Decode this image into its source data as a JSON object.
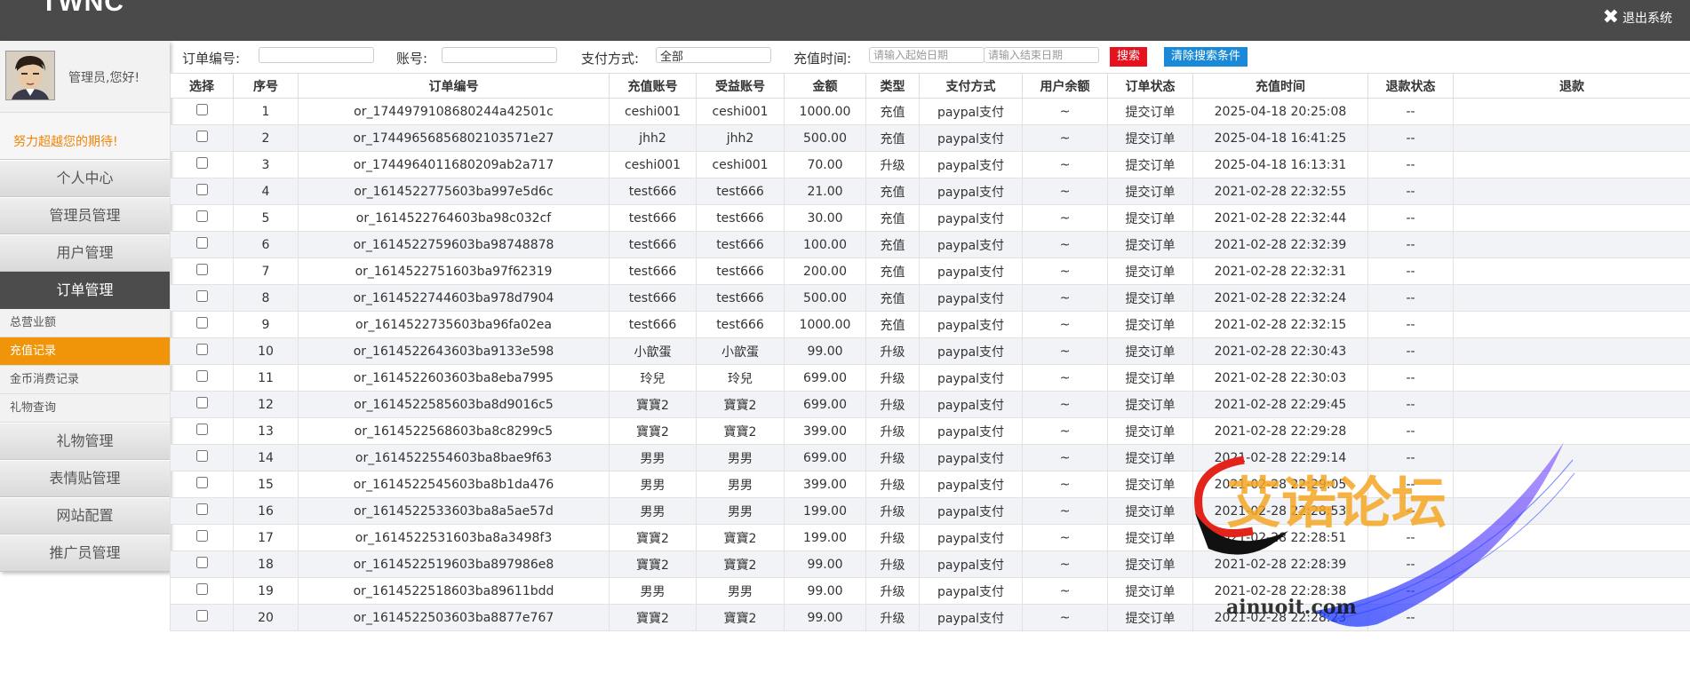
{
  "app": {
    "logo": "TWNC",
    "logout": "退出系统"
  },
  "user": {
    "greeting": "管理员,您好!",
    "motto": "努力超越您的期待!"
  },
  "nav": [
    {
      "label": "个人中心"
    },
    {
      "label": "管理员管理"
    },
    {
      "label": "用户管理"
    },
    {
      "label": "订单管理",
      "active": true,
      "sub": [
        {
          "label": "总营业额"
        },
        {
          "label": "充值记录",
          "active": true
        },
        {
          "label": "金币消费记录"
        },
        {
          "label": "礼物查询"
        }
      ]
    },
    {
      "label": "礼物管理"
    },
    {
      "label": "表情贴管理"
    },
    {
      "label": "网站配置"
    },
    {
      "label": "推广员管理"
    }
  ],
  "search": {
    "order_label": "订单编号:",
    "account_label": "账号:",
    "pay_label": "支付方式:",
    "pay_value": "全部",
    "time_label": "充值时间:",
    "start_placeholder": "请输入起始日期",
    "end_placeholder": "请输入结束日期",
    "search_btn": "搜索",
    "clear_btn": "清除搜索条件"
  },
  "table": {
    "headers": [
      "选择",
      "序号",
      "订单编号",
      "充值账号",
      "受益账号",
      "金额",
      "类型",
      "支付方式",
      "用户余额",
      "订单状态",
      "充值时间",
      "退款状态",
      "退款"
    ],
    "rows": [
      [
        "1",
        "or_1744979108680244a42501c",
        "ceshi001",
        "ceshi001",
        "1000.00",
        "充值",
        "paypal支付",
        "~",
        "提交订单",
        "2025-04-18 20:25:08",
        "--"
      ],
      [
        "2",
        "or_17449656856802103571e27",
        "jhh2",
        "jhh2",
        "500.00",
        "充值",
        "paypal支付",
        "~",
        "提交订单",
        "2025-04-18 16:41:25",
        "--"
      ],
      [
        "3",
        "or_1744964011680209ab2a717",
        "ceshi001",
        "ceshi001",
        "70.00",
        "升级",
        "paypal支付",
        "~",
        "提交订单",
        "2025-04-18 16:13:31",
        "--"
      ],
      [
        "4",
        "or_1614522775603ba997e5d6c",
        "test666",
        "test666",
        "21.00",
        "充值",
        "paypal支付",
        "~",
        "提交订单",
        "2021-02-28 22:32:55",
        "--"
      ],
      [
        "5",
        "or_1614522764603ba98c032cf",
        "test666",
        "test666",
        "30.00",
        "充值",
        "paypal支付",
        "~",
        "提交订单",
        "2021-02-28 22:32:44",
        "--"
      ],
      [
        "6",
        "or_1614522759603ba98748878",
        "test666",
        "test666",
        "100.00",
        "充值",
        "paypal支付",
        "~",
        "提交订单",
        "2021-02-28 22:32:39",
        "--"
      ],
      [
        "7",
        "or_1614522751603ba97f62319",
        "test666",
        "test666",
        "200.00",
        "充值",
        "paypal支付",
        "~",
        "提交订单",
        "2021-02-28 22:32:31",
        "--"
      ],
      [
        "8",
        "or_1614522744603ba978d7904",
        "test666",
        "test666",
        "500.00",
        "充值",
        "paypal支付",
        "~",
        "提交订单",
        "2021-02-28 22:32:24",
        "--"
      ],
      [
        "9",
        "or_1614522735603ba96fa02ea",
        "test666",
        "test666",
        "1000.00",
        "充值",
        "paypal支付",
        "~",
        "提交订单",
        "2021-02-28 22:32:15",
        "--"
      ],
      [
        "10",
        "or_1614522643603ba9133e598",
        "小歆蛋",
        "小歆蛋",
        "99.00",
        "升级",
        "paypal支付",
        "~",
        "提交订单",
        "2021-02-28 22:30:43",
        "--"
      ],
      [
        "11",
        "or_1614522603603ba8eba7995",
        "玲兒",
        "玲兒",
        "699.00",
        "升级",
        "paypal支付",
        "~",
        "提交订单",
        "2021-02-28 22:30:03",
        "--"
      ],
      [
        "12",
        "or_1614522585603ba8d9016c5",
        "寶寶2",
        "寶寶2",
        "699.00",
        "升级",
        "paypal支付",
        "~",
        "提交订单",
        "2021-02-28 22:29:45",
        "--"
      ],
      [
        "13",
        "or_1614522568603ba8c8299c5",
        "寶寶2",
        "寶寶2",
        "399.00",
        "升级",
        "paypal支付",
        "~",
        "提交订单",
        "2021-02-28 22:29:28",
        "--"
      ],
      [
        "14",
        "or_1614522554603ba8bae9f63",
        "男男",
        "男男",
        "699.00",
        "升级",
        "paypal支付",
        "~",
        "提交订单",
        "2021-02-28 22:29:14",
        "--"
      ],
      [
        "15",
        "or_1614522545603ba8b1da476",
        "男男",
        "男男",
        "399.00",
        "升级",
        "paypal支付",
        "~",
        "提交订单",
        "2021-02-28 22:29:05",
        "--"
      ],
      [
        "16",
        "or_1614522533603ba8a5ae57d",
        "男男",
        "男男",
        "199.00",
        "升级",
        "paypal支付",
        "~",
        "提交订单",
        "2021-02-28 22:28:53",
        "--"
      ],
      [
        "17",
        "or_1614522531603ba8a3498f3",
        "寶寶2",
        "寶寶2",
        "199.00",
        "升级",
        "paypal支付",
        "~",
        "提交订单",
        "2021-02-28 22:28:51",
        "--"
      ],
      [
        "18",
        "or_1614522519603ba897986e8",
        "寶寶2",
        "寶寶2",
        "99.00",
        "升级",
        "paypal支付",
        "~",
        "提交订单",
        "2021-02-28 22:28:39",
        "--"
      ],
      [
        "19",
        "or_1614522518603ba89611bdd",
        "男男",
        "男男",
        "99.00",
        "升级",
        "paypal支付",
        "~",
        "提交订单",
        "2021-02-28 22:28:38",
        "--"
      ],
      [
        "20",
        "or_1614522503603ba8877e767",
        "寶寶2",
        "寶寶2",
        "99.00",
        "升级",
        "paypal支付",
        "~",
        "提交订单",
        "2021-02-28 22:28:23",
        "--"
      ]
    ]
  },
  "watermark": {
    "text": "艾诺论坛",
    "url": "ainuoit.com"
  },
  "colors": {
    "topbar": "#4a4a4a",
    "accent": "#f0950a",
    "search_btn": "#e8121f",
    "clear_btn": "#1a8ad8"
  }
}
